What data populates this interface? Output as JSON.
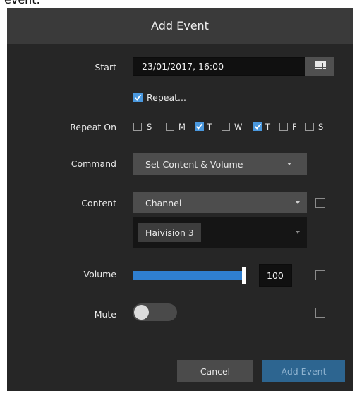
{
  "page_top_text": "event.",
  "dialog": {
    "title": "Add Event",
    "start": {
      "label": "Start",
      "value": "23/01/2017, 16:00"
    },
    "repeat": {
      "label": "Repeat...",
      "checked": true
    },
    "repeat_on": {
      "label": "Repeat On",
      "days": [
        {
          "letter": "S",
          "checked": false
        },
        {
          "letter": "M",
          "checked": false
        },
        {
          "letter": "T",
          "checked": true
        },
        {
          "letter": "W",
          "checked": false
        },
        {
          "letter": "T",
          "checked": true
        },
        {
          "letter": "F",
          "checked": false
        },
        {
          "letter": "S",
          "checked": false
        }
      ]
    },
    "command": {
      "label": "Command",
      "value": "Set Content & Volume"
    },
    "content": {
      "label": "Content",
      "type_value": "Channel",
      "channel_value": "Haivision 3",
      "checked": false
    },
    "volume": {
      "label": "Volume",
      "value": "100",
      "level": 1.0,
      "checked": false
    },
    "mute": {
      "label": "Mute",
      "on": false,
      "checked": false
    },
    "buttons": {
      "cancel": "Cancel",
      "add": "Add Event"
    }
  },
  "colors": {
    "accent": "#4a98de",
    "slider": "#2f7fd0",
    "add_button_bg": "#2d6590",
    "dialog_bg": "#262626"
  }
}
